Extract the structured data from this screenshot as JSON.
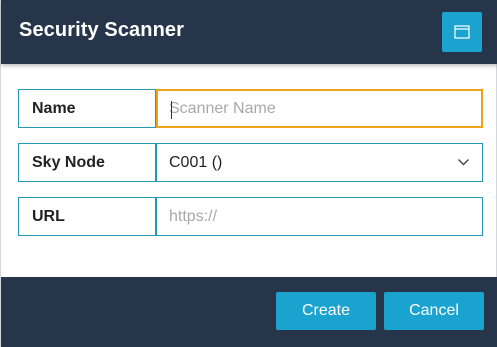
{
  "dialog": {
    "title": "Security Scanner",
    "window_button_icon": "window-maximize-icon"
  },
  "form": {
    "name": {
      "label": "Name",
      "value": "",
      "placeholder": "Scanner Name"
    },
    "sky_node": {
      "label": "Sky Node",
      "selected": "C001 ()",
      "icon": "chevron-down-icon"
    },
    "url": {
      "label": "URL",
      "value": "",
      "placeholder": "https://"
    }
  },
  "footer": {
    "create_label": "Create",
    "cancel_label": "Cancel"
  },
  "colors": {
    "header_bg": "#26354a",
    "accent": "#1aa3cf",
    "field_border": "#2498b8",
    "focus_border": "#f0a21a"
  }
}
